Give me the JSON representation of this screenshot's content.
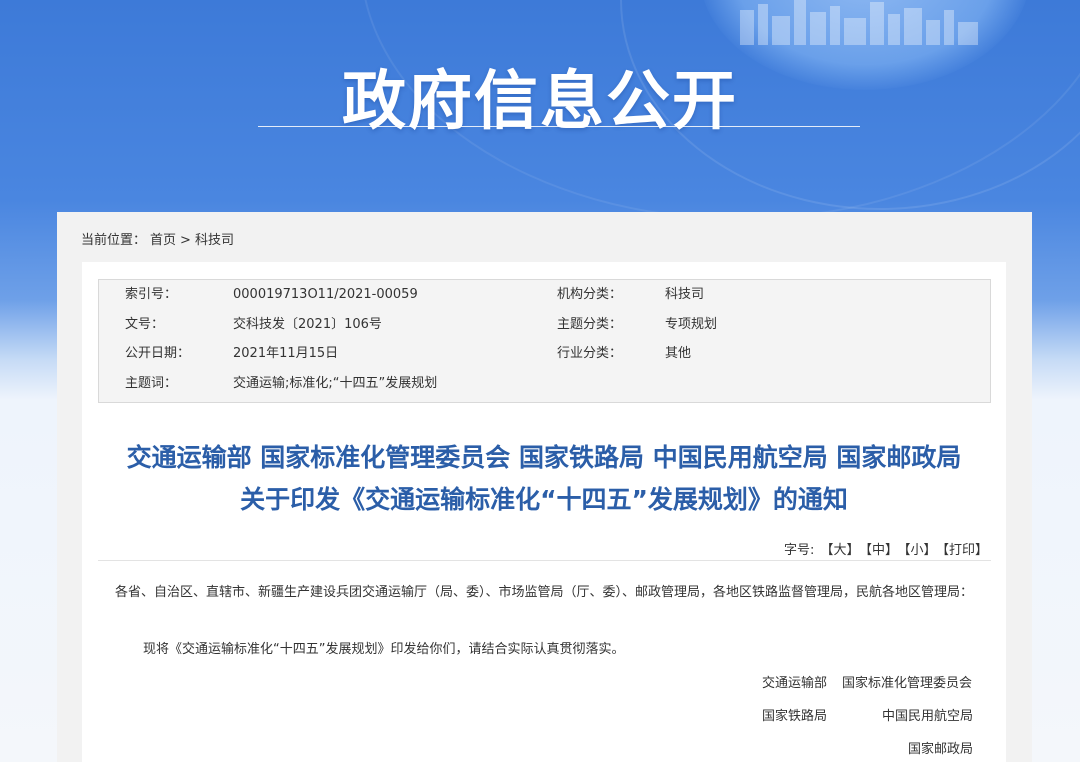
{
  "banner": {
    "title": "政府信息公开"
  },
  "breadcrumb": {
    "label": "当前位置：",
    "home": "首页",
    "separator": ">",
    "current": "科技司"
  },
  "meta": {
    "index_key": "索引号：",
    "index_val": "000019713O11/2021-00059",
    "org_key": "机构分类：",
    "org_val": "科技司",
    "docno_key": "文号：",
    "docno_val": "交科技发〔2021〕106号",
    "topic_key": "主题分类：",
    "topic_val": "专项规划",
    "date_key": "公开日期：",
    "date_val": "2021年11月15日",
    "industry_key": "行业分类：",
    "industry_val": "其他",
    "keywords_key": "主题词：",
    "keywords_val": "交通运输;标准化;“十四五”发展规划"
  },
  "article": {
    "title_line1": "交通运输部 国家标准化管理委员会 国家铁路局 中国民用航空局 国家邮政局",
    "title_line2": "关于印发《交通运输标准化“十四五”发展规划》的通知",
    "font_size_label": "字号:",
    "size_large": "【大】",
    "size_medium": "【中】",
    "size_small": "【小】",
    "print": "【打印】",
    "recipients": "各省、自治区、直辖市、新疆生产建设兵团交通运输厅（局、委）、市场监管局（厅、委）、邮政管理局，各地区铁路监督管理局，民航各地区管理局：",
    "paragraph1": "现将《交通运输标准化“十四五”发展规划》印发给你们，请结合实际认真贯彻落实。",
    "signatories": {
      "s1": "交通运输部",
      "s2": "国家标准化管理委员会",
      "s3": "国家铁路局",
      "s4": "中国民用航空局",
      "s5": "国家邮政局"
    }
  },
  "colors": {
    "banner_blue": "#3d7ad8",
    "title_blue": "#2b5ea8",
    "panel_gray": "#f2f2f2",
    "meta_bg": "#f4f4f4"
  }
}
